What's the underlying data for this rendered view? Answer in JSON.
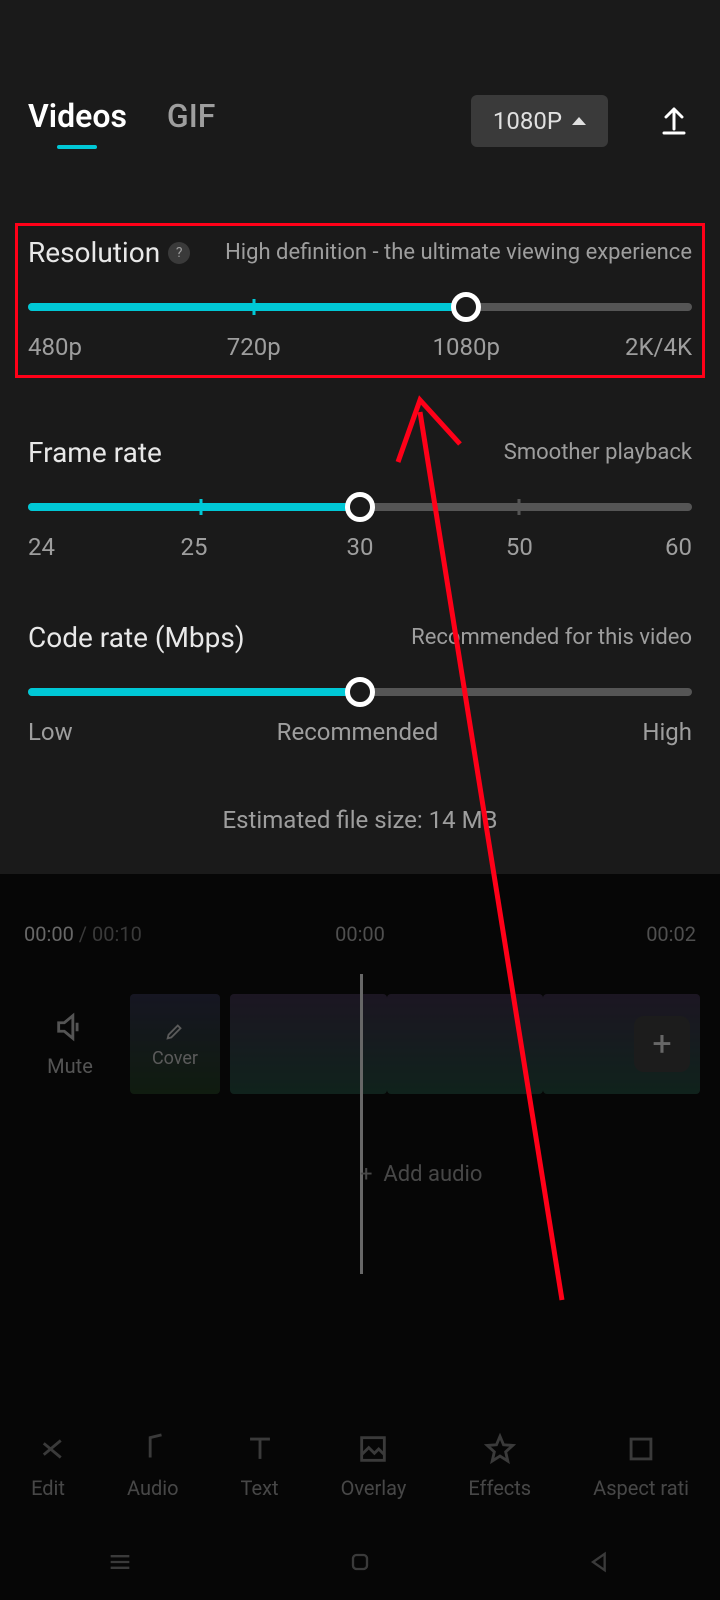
{
  "header": {
    "tab_videos": "Videos",
    "tab_gif": "GIF",
    "resolution_selected": "1080P"
  },
  "resolution": {
    "title": "Resolution",
    "help": "?",
    "hint": "High definition - the ultimate viewing experience",
    "labels": [
      "480p",
      "720p",
      "1080p",
      "2K/4K"
    ],
    "fill_percent": 66,
    "tick_percents": [
      34
    ],
    "thumb_percent": 66
  },
  "framerate": {
    "title": "Frame rate",
    "hint": "Smoother playback",
    "labels": [
      "24",
      "25",
      "30",
      "50",
      "60"
    ],
    "fill_percent": 50,
    "tick_percents": [
      26
    ],
    "grey_tick_percents": [
      74
    ],
    "thumb_percent": 50
  },
  "coderate": {
    "title": "Code rate (Mbps)",
    "hint": "Recommended for this video",
    "labels": [
      "Low",
      "Recommended",
      "High"
    ],
    "fill_percent": 50,
    "thumb_percent": 50
  },
  "estimated": "Estimated file size: 14 MB",
  "editor": {
    "time_current": "00:00",
    "time_total": "00:10",
    "mid_time": "00:00",
    "right_time": "00:02",
    "mute": "Mute",
    "cover": "Cover",
    "add_audio": "Add audio",
    "plus": "+"
  },
  "tools": {
    "edit": "Edit",
    "audio": "Audio",
    "text": "Text",
    "overlay": "Overlay",
    "effects": "Effects",
    "aspect": "Aspect rati"
  }
}
